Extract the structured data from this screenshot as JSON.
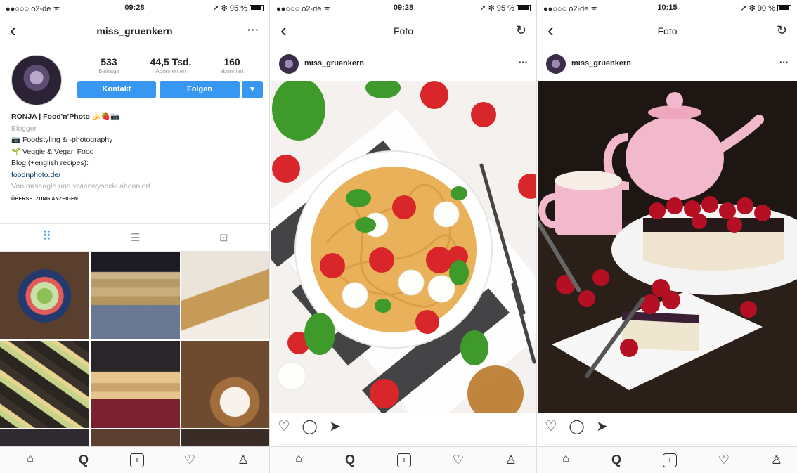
{
  "screens": [
    {
      "status": {
        "carrier": "●●○○○ o2-de ᯤ",
        "time": "09:28",
        "battery": "➚ ✻ 95 %"
      },
      "nav": {
        "back": "‹",
        "title": "miss_gruenkern",
        "more": "···"
      },
      "stats": [
        {
          "num": "533",
          "label": "Beiträge"
        },
        {
          "num": "44,5 Tsd.",
          "label": "Abonnenten"
        },
        {
          "num": "160",
          "label": "abonniert"
        }
      ],
      "buttons": {
        "contact": "Kontakt",
        "follow": "Folgen",
        "dropdown": "▾"
      },
      "bio": {
        "name": "RONJA | Food'n'Photo 🍌🍓📷",
        "category": "Blogger",
        "line1": "📷 Foodstyling & -photography",
        "line2": "🌱 Veggie & Vegan Food",
        "line3": "Blog (+english recipes):",
        "link": "foodnphoto.de/",
        "followed_by": "Von mrseagle und vivienwysocki abonniert",
        "translate": "ÜBERSETZUNG ANZEIGEN"
      },
      "tabs": {
        "grid": "⠿",
        "list": "☰",
        "tagged": "⊡"
      }
    },
    {
      "status": {
        "carrier": "●●○○○ o2-de ᯤ",
        "time": "09:28",
        "battery": "➚ ✻ 95 %"
      },
      "nav": {
        "back": "‹",
        "title": "Foto",
        "refresh": "↻"
      },
      "post": {
        "user": "miss_gruenkern",
        "more": "···"
      }
    },
    {
      "status": {
        "carrier": "●●○○○ o2-de ᯤ",
        "time": "10:15",
        "battery": "➚ ✻ 90 %"
      },
      "nav": {
        "back": "‹",
        "title": "Foto",
        "refresh": "↻"
      },
      "post": {
        "user": "miss_gruenkern",
        "more": "···"
      }
    }
  ],
  "post_actions": {
    "like": "♡",
    "comment": "◯",
    "share": "➤"
  },
  "tabbar": {
    "home": "⌂",
    "search": "Q",
    "add": "+",
    "activity": "♡",
    "profile": "♙"
  },
  "colors": {
    "accent": "#3897f0",
    "link": "#003569"
  }
}
